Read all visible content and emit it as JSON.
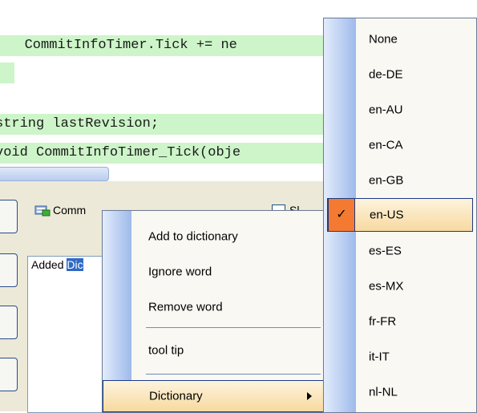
{
  "editor": {
    "lines": [
      "   CommitInfoTimer.Tick += ne",
      "",
      "string lastRevision;",
      "void CommitInfoTimer_Tick(obje"
    ]
  },
  "panel": {
    "commit_label": "Comm",
    "checkbox_label": "Sl",
    "textbox_prefix": "Added ",
    "textbox_selected": "Dic"
  },
  "context_menu": {
    "items": [
      "Add to dictionary",
      "Ignore word",
      "Remove word",
      "tool tip",
      "Dictionary"
    ]
  },
  "dictionary_menu": {
    "items": [
      "None",
      "de-DE",
      "en-AU",
      "en-CA",
      "en-GB",
      "en-US",
      "es-ES",
      "es-MX",
      "fr-FR",
      "it-IT",
      "nl-NL"
    ],
    "selected": "en-US",
    "check_glyph": "✓"
  },
  "colors": {
    "code_highlight": "#cdf5c9",
    "menu_highlight": "#f8d9a0",
    "check_highlight": "#f47a32"
  }
}
